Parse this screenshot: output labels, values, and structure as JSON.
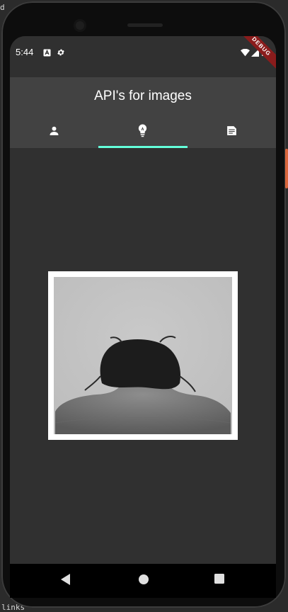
{
  "ide": {
    "top_fragment": "d",
    "bottom_fragment": "links"
  },
  "status_bar": {
    "time": "5:44",
    "left_icons": [
      "a-notification-icon",
      "gear-icon"
    ],
    "right_icons": [
      "wifi-icon",
      "signal-icon",
      "battery-icon"
    ],
    "debug_banner": "DEBUG"
  },
  "app_bar": {
    "title": "API's for images",
    "tabs": [
      {
        "icon": "person-icon",
        "active": false
      },
      {
        "icon": "lightbulb-icon",
        "active": true
      },
      {
        "icon": "document-icon",
        "active": false
      }
    ],
    "indicator_color": "#64ffda"
  },
  "content": {
    "image": {
      "description_icon": "grayscale-photo"
    }
  },
  "nav_bar": {
    "buttons": [
      "back-icon",
      "home-icon",
      "recents-icon"
    ]
  },
  "colors": {
    "background": "#303030",
    "app_bar": "#424242",
    "accent": "#64ffda"
  }
}
